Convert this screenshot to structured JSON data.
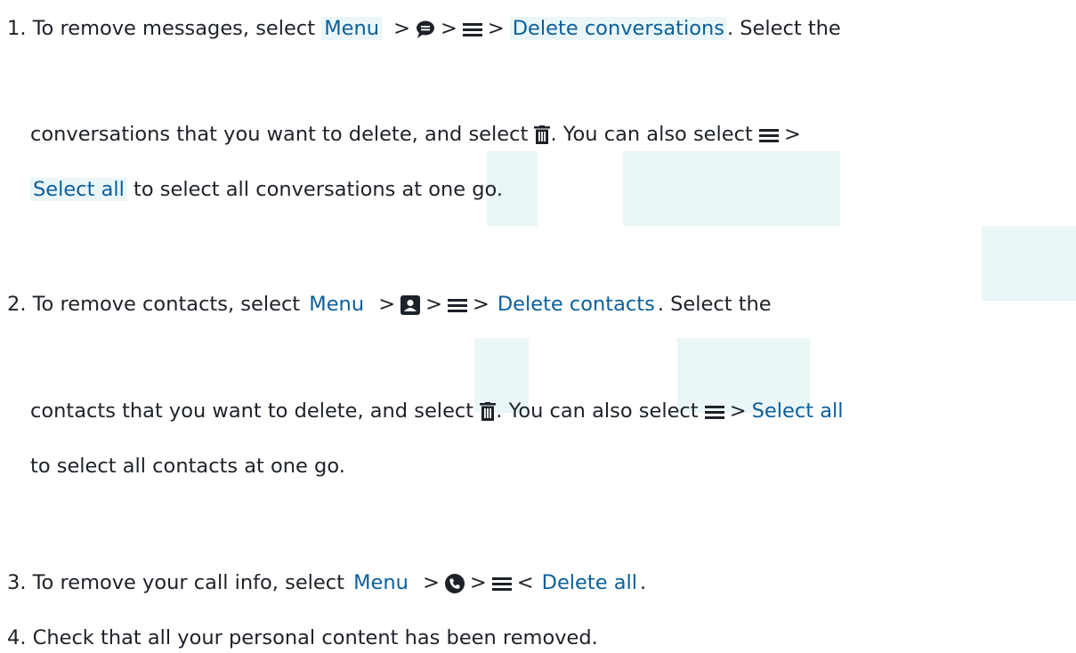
{
  "steps": [
    {
      "num": "1.",
      "p1": "To remove messages, select ",
      "k1": "Menu",
      "k2": "Delete conversations",
      "p2": ". Select the",
      "p3": "conversations that you want to delete, and select ",
      "p4": ". You can also select ",
      "k3": "Select all",
      "p5": " to select all conversations at one go."
    },
    {
      "num": "2.",
      "p1": "To remove contacts, select ",
      "k1": "Menu",
      "k2": "Delete contacts",
      "p2": ". Select the",
      "p3": "contacts that you want to delete, and select ",
      "p4": ". You can also select ",
      "k3": "Select all",
      "p5": "to select all contacts at one go."
    },
    {
      "num": "3.",
      "p1": "To remove your call info, select ",
      "k1": "Menu",
      "k2": "Delete all",
      "p2": "."
    },
    {
      "num": "4.",
      "p1": "Check that all your personal content has been removed."
    }
  ],
  "symbols": {
    "gt": ">",
    "lt": "<"
  },
  "icons": {
    "messages": "chat-bubble-icon",
    "contacts": "contact-card-icon",
    "calls": "phone-icon",
    "options": "hamburger-menu-icon",
    "delete": "trash-icon"
  },
  "colors": {
    "highlight_bg": "#eaf6f8",
    "highlight_text": "#0b5f9c",
    "text": "#1d2229"
  }
}
